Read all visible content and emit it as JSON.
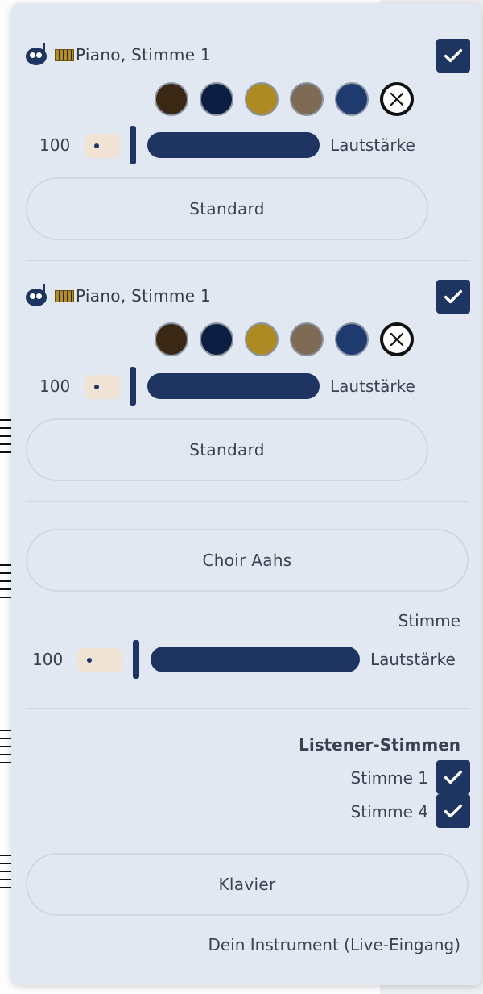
{
  "tracks": [
    {
      "name": "Piano, Stimme 1",
      "enabled": true,
      "colors": [
        "#3a2814",
        "#0c1f42",
        "#ad8a22",
        "#7f6a56",
        "#1e3a6e"
      ],
      "volume": "100",
      "volume_label": "Lautstärke",
      "sound_button": "Standard"
    },
    {
      "name": "Piano, Stimme 1",
      "enabled": true,
      "colors": [
        "#3a2814",
        "#0c1f42",
        "#ad8a22",
        "#7f6a56",
        "#1e3a6e"
      ],
      "volume": "100",
      "volume_label": "Lautstärke",
      "sound_button": "Standard"
    }
  ],
  "choir": {
    "instrument_button": "Choir Aahs",
    "caption": "Stimme",
    "volume": "100",
    "volume_label": "Lautstärke"
  },
  "listener": {
    "title": "Listener-Stimmen",
    "voices": [
      {
        "label": "Stimme 1",
        "checked": true
      },
      {
        "label": "Stimme 4",
        "checked": true
      }
    ]
  },
  "live_input": {
    "instrument_button": "Klavier",
    "caption": "Dein Instrument (Live-Eingang)"
  },
  "colors": {
    "panel_bg": "#e2e8f2",
    "accent": "#1e3561",
    "volume_pill": "#f1e3d3"
  }
}
